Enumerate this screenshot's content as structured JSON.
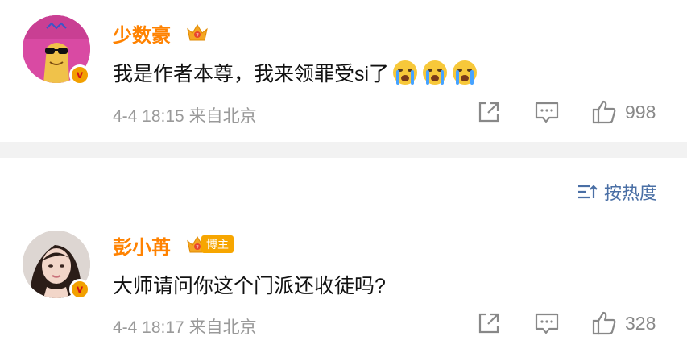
{
  "comments": [
    {
      "username": "少数豪",
      "text": "我是作者本尊，我来领罪受si了",
      "emoji_count": 3,
      "emoji": "crying-face-icon",
      "time": "4-4 18:15",
      "source": "来自北京",
      "likes": "998",
      "verified": true
    },
    {
      "username": "彭小苒",
      "tag": "博主",
      "text": "大师请问你这个门派还收徒吗?",
      "time": "4-4 18:17",
      "source": "来自北京",
      "likes": "328",
      "verified": true
    }
  ],
  "sort": {
    "label": "按热度"
  },
  "colors": {
    "username": "#ff8200",
    "meta": "#9a9a9a",
    "sort": "#4a6fa5",
    "divider": "#f2f2f2"
  }
}
